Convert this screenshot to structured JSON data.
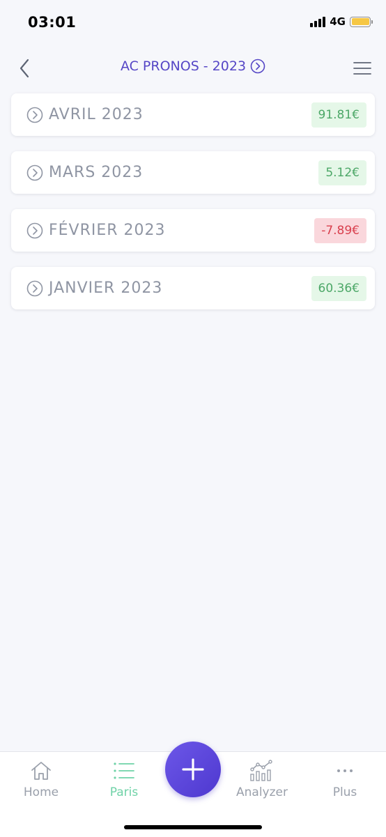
{
  "status_bar": {
    "time": "03:01",
    "network": "4G",
    "battery_color": "#f6c744"
  },
  "header": {
    "back_icon": "chevron-left-icon",
    "title": "AC PRONOS - 2023",
    "title_icon": "circle-chevron-right-icon",
    "menu_icon": "hamburger-menu-icon",
    "title_color": "#5546c6"
  },
  "months": [
    {
      "label": "AVRIL 2023",
      "amount": "91.81€",
      "status": "positive"
    },
    {
      "label": "MARS 2023",
      "amount": "5.12€",
      "status": "positive"
    },
    {
      "label": "FÉVRIER 2023",
      "amount": "-7.89€",
      "status": "negative"
    },
    {
      "label": "JANVIER 2023",
      "amount": "60.36€",
      "status": "positive"
    }
  ],
  "colors": {
    "positive_bg": "#e5f7e8",
    "positive_text": "#4ca767",
    "negative_bg": "#fad7dc",
    "negative_text": "#d9404e",
    "accent": "#5546c6",
    "tab_active": "#6fd2a7"
  },
  "tab_bar": {
    "home": {
      "label": "Home",
      "icon": "home-icon"
    },
    "paris": {
      "label": "Paris",
      "icon": "list-icon",
      "active": true
    },
    "add": {
      "icon": "plus-icon"
    },
    "analyzer": {
      "label": "Analyzer",
      "icon": "chart-icon"
    },
    "plus": {
      "label": "Plus",
      "icon": "more-dots-icon"
    }
  }
}
